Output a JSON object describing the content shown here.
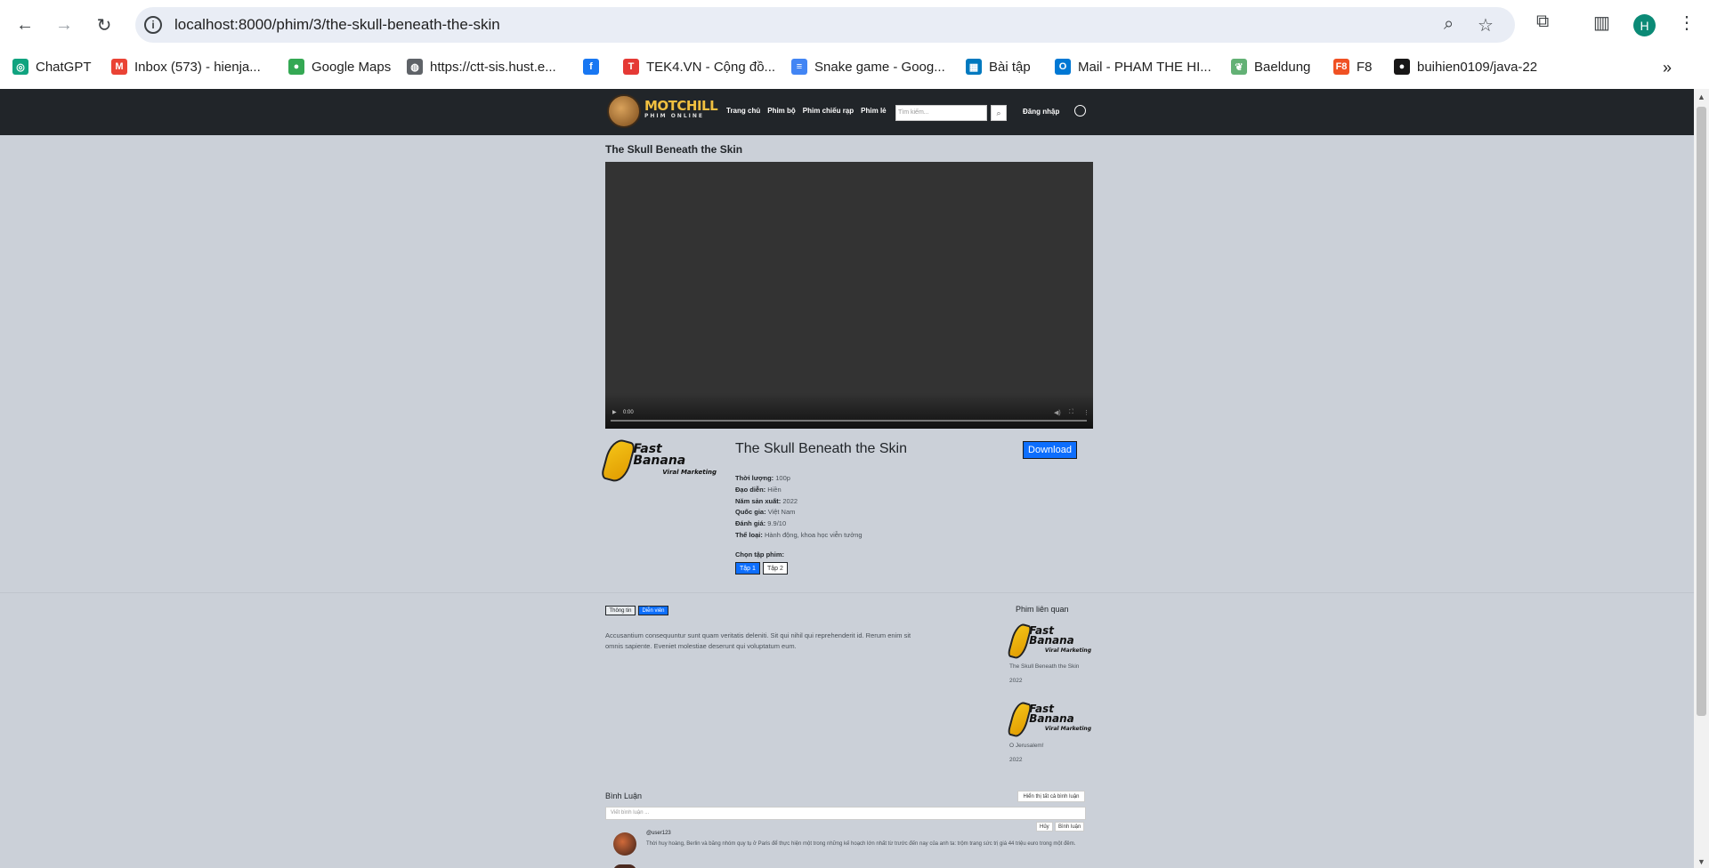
{
  "browser": {
    "url": "localhost:8000/phim/3/the-skull-beneath-the-skin",
    "profile_initial": "H",
    "bookmarks": [
      {
        "label": "ChatGPT",
        "icon": "chatgpt-icon",
        "color": "#10a37f"
      },
      {
        "label": "Inbox (573) - hienja...",
        "icon": "gmail-icon",
        "color": "#ea4335"
      },
      {
        "label": "Google Maps",
        "icon": "maps-pin-icon",
        "color": "#34a853"
      },
      {
        "label": "https://ctt-sis.hust.e...",
        "icon": "globe-icon",
        "color": "#5f6368"
      },
      {
        "label": "",
        "icon": "facebook-icon",
        "color": "#1877f2"
      },
      {
        "label": "TEK4.VN - Cộng đồ...",
        "icon": "tek4-icon",
        "color": "#e53935"
      },
      {
        "label": "Snake game - Goog...",
        "icon": "docs-icon",
        "color": "#4285f4"
      },
      {
        "label": "Bài tập",
        "icon": "trello-icon",
        "color": "#0079bf"
      },
      {
        "label": "Mail - PHAM THE HI...",
        "icon": "outlook-icon",
        "color": "#0078d4"
      },
      {
        "label": "Baeldung",
        "icon": "baeldung-icon",
        "color": "#63b175"
      },
      {
        "label": "F8",
        "icon": "f8-icon",
        "color": "#f05123"
      },
      {
        "label": "buihien0109/java-22",
        "icon": "github-icon",
        "color": "#181717"
      }
    ]
  },
  "site": {
    "brand": "MOTCHILL",
    "brand_sub": "PHIM ONLINE",
    "menu": [
      "Trang chủ",
      "Phim bộ",
      "Phim chiếu rạp",
      "Phim lẻ"
    ],
    "search_placeholder": "Tìm kiếm...",
    "login": "Đăng nhập"
  },
  "movie": {
    "heading": "The Skull Beneath the Skin",
    "title": "The Skull Beneath the Skin",
    "download_label": "Download",
    "video_time": "0:00",
    "poster_text": "Fast Banana",
    "poster_sub": "Viral Marketing",
    "info": [
      {
        "label": "Thời lượng:",
        "value": "100p"
      },
      {
        "label": "Đạo diễn:",
        "value": "Hiền"
      },
      {
        "label": "Năm sản xuất:",
        "value": "2022"
      },
      {
        "label": "Quốc gia:",
        "value": "Việt Nam"
      },
      {
        "label": "Đánh giá:",
        "value": "9.9/10"
      },
      {
        "label": "Thể loại:",
        "value": "Hành động, khoa học viễn tưởng"
      }
    ],
    "episode_label": "Chọn tập phim:",
    "episodes": [
      {
        "label": "Tập 1",
        "active": true
      },
      {
        "label": "Tập 2",
        "active": false
      }
    ]
  },
  "tabs": {
    "info": "Thông tin",
    "cast": "Diễn viên",
    "active": "cast"
  },
  "description": "Accusantium consequuntur sunt quam veritatis deleniti. Sit qui nihil qui reprehenderit id. Rerum enim sit omnis sapiente. Eveniet molestiae deserunt qui voluptatum eum.",
  "related": {
    "title": "Phim liên quan",
    "items": [
      {
        "name": "The Skull Beneath the Skin",
        "year": "2022"
      },
      {
        "name": "O Jerusalem!",
        "year": "2022"
      }
    ]
  },
  "comments": {
    "title": "Bình Luận",
    "show_all": "Hiển thị tất cả bình luận",
    "input_placeholder": "Viết bình luận ...",
    "cancel": "Hủy",
    "submit": "Bình luận",
    "items": [
      {
        "user": "@user123",
        "text": "Thời huy hoàng, Berlin và băng nhóm quy tụ ở Paris để thực hiện một trong những kế hoạch lớn nhất từ trước đến nay của anh ta: trộm trang sức trị giá 44 triệu euro trong một đêm."
      }
    ]
  }
}
